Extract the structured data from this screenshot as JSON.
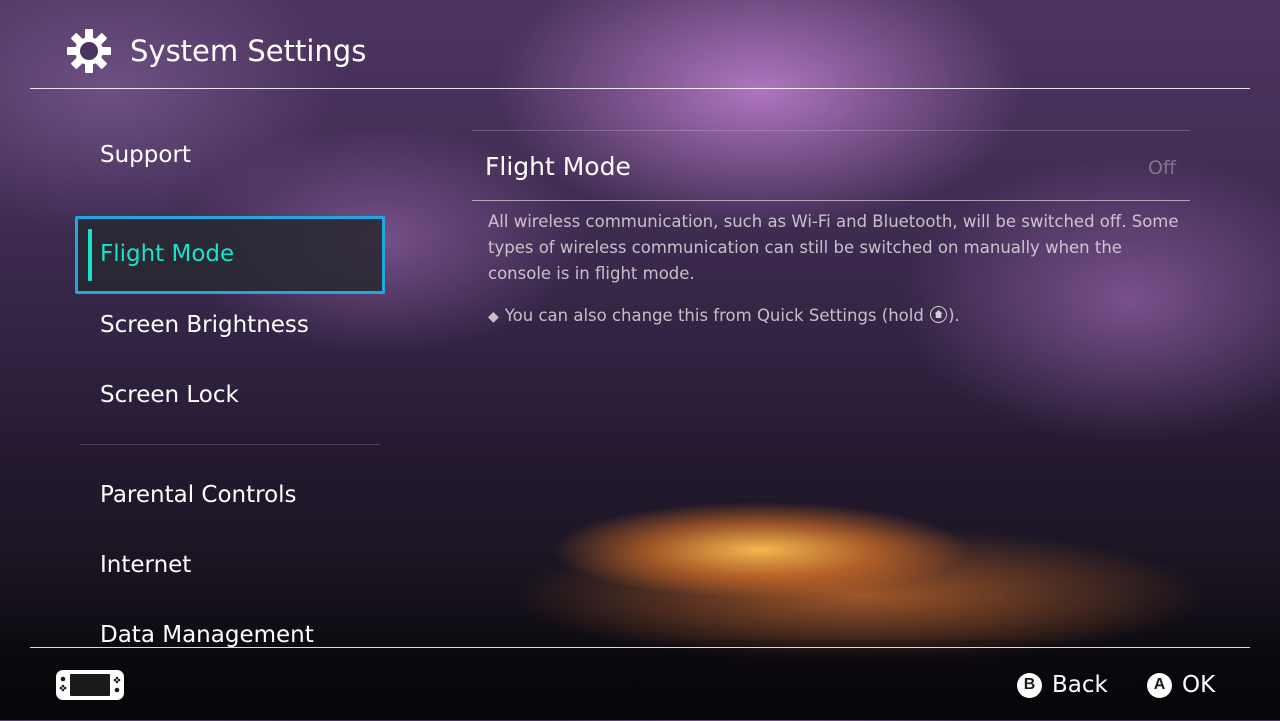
{
  "header": {
    "title": "System Settings",
    "icon": "gear-icon"
  },
  "sidebar": {
    "items": [
      {
        "label": "Support"
      },
      {
        "label": "Flight Mode",
        "selected": true
      },
      {
        "label": "Screen Brightness"
      },
      {
        "label": "Screen Lock"
      },
      {
        "label": "Parental Controls"
      },
      {
        "label": "Internet"
      },
      {
        "label": "Data Management"
      }
    ]
  },
  "detail": {
    "setting_label": "Flight Mode",
    "setting_value": "Off",
    "description": "All wireless communication, such as Wi-Fi and Bluetooth, will be switched off. Some types of wireless communication can still be switched on manually when the console is in flight mode.",
    "hint_text": "You can also change this from Quick Settings (hold ",
    "hint_suffix": ").",
    "hint_icon": "home-button-icon"
  },
  "footer": {
    "back_button": {
      "key": "B",
      "label": "Back"
    },
    "ok_button": {
      "key": "A",
      "label": "OK"
    },
    "console_icon": "console-icon"
  },
  "colors": {
    "accent_text": "#19e3c8",
    "selection_border": "#1ea8e0",
    "text": "#ffffff"
  }
}
